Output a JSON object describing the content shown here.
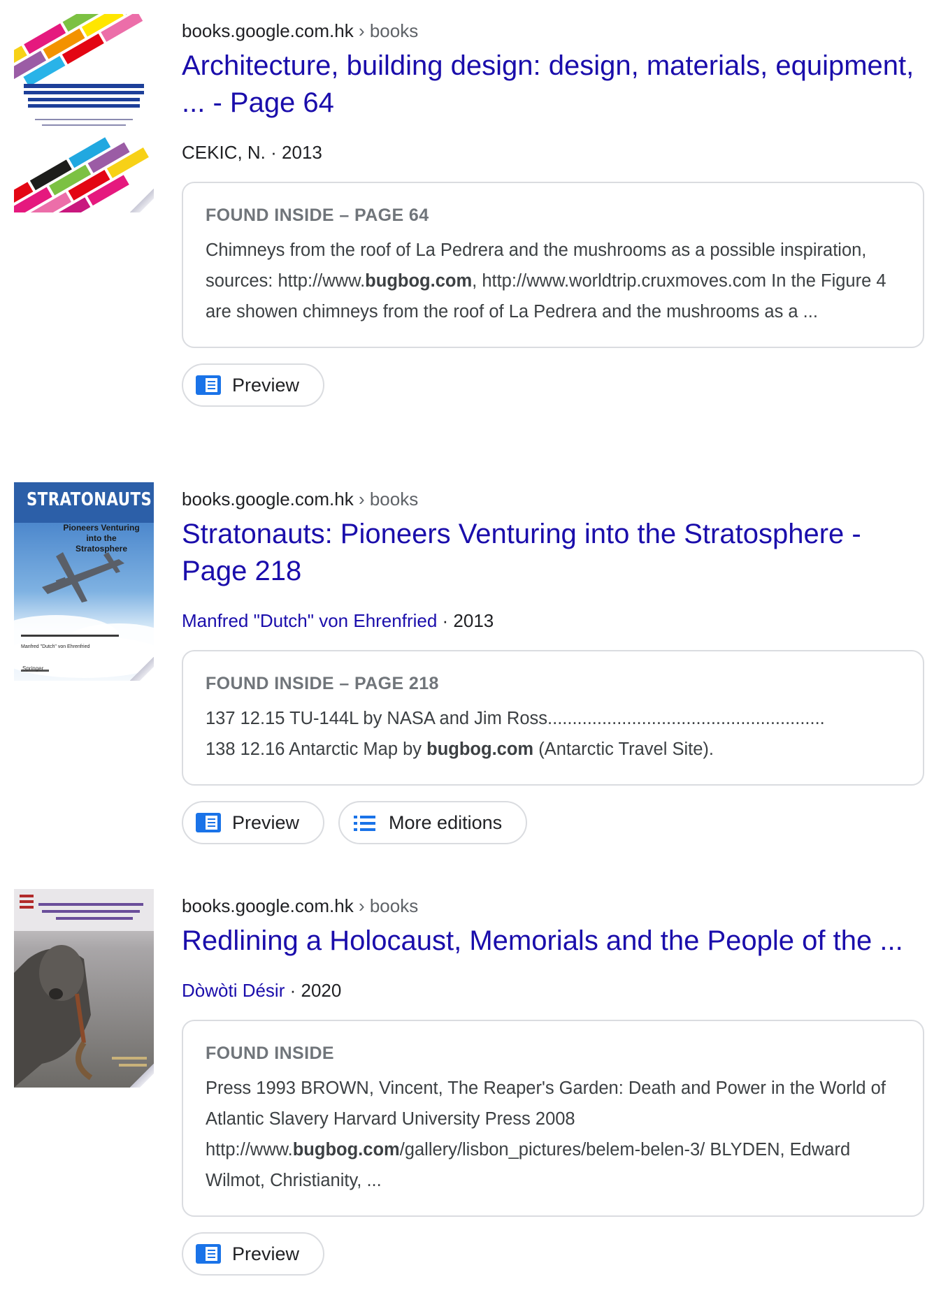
{
  "results": [
    {
      "site": "books.google.com.hk",
      "crumb": " › books",
      "title": "Architecture, building design: design, materials, equipment, ... - Page 64",
      "author": "CEKIC, N.",
      "year": " · 2013",
      "found_label": "FOUND INSIDE – PAGE 64",
      "snippet_parts": [
        "Chimneys from the roof of La Pedrera and the mushrooms as a possible inspiration, sources: http://www.",
        "bugbog.com",
        ", http://www.worldtrip.cruxmoves.com In the Figure 4 are showen chimneys from the roof of La Pedrera and the mushrooms as a ..."
      ],
      "preview_label": "Preview"
    },
    {
      "site": "books.google.com.hk",
      "crumb": " › books",
      "title": "Stratonauts: Pioneers Venturing into the Stratosphere - Page 218",
      "author": "Manfred \"Dutch\" von Ehrenfried",
      "year": " · 2013",
      "found_label": "FOUND INSIDE – PAGE 218",
      "snippet_line1": "137 12.15 TU-144L by NASA and Jim Ross........................................................",
      "snippet_parts": [
        "138 12.16 Antarctic Map by ",
        "bugbog.com",
        " (Antarctic Travel Site)."
      ],
      "preview_label": "Preview",
      "more_editions_label": "More editions",
      "cover_title": "STRATONAUTS",
      "cover_subtitle": "Pioneers Venturing into the Stratosphere",
      "cover_author": "Manfred \"Dutch\" von Ehrenfried",
      "cover_publisher": "Springer"
    },
    {
      "site": "books.google.com.hk",
      "crumb": " › books",
      "title": "Redlining a Holocaust, Memorials and the People of the ...",
      "author": "Dòwòti Désir",
      "year": " · 2020",
      "found_label": "FOUND INSIDE",
      "snippet_parts": [
        "Press 1993 BROWN, Vincent, The Reaper's Garden: Death and Power in the World of Atlantic Slavery Harvard University Press 2008 http://www.",
        "bugbog.com",
        "/gallery/lisbon_pictures/belem-belen-3/ BLYDEN, Edward Wilmot, Christianity, ..."
      ],
      "preview_label": "Preview"
    }
  ],
  "colors": {
    "link": "#1a0dab",
    "text": "#202124",
    "muted": "#70757a",
    "border": "#dadce0",
    "icon_blue": "#1a73e8"
  },
  "icons": [
    "book-icon",
    "list-icon"
  ]
}
